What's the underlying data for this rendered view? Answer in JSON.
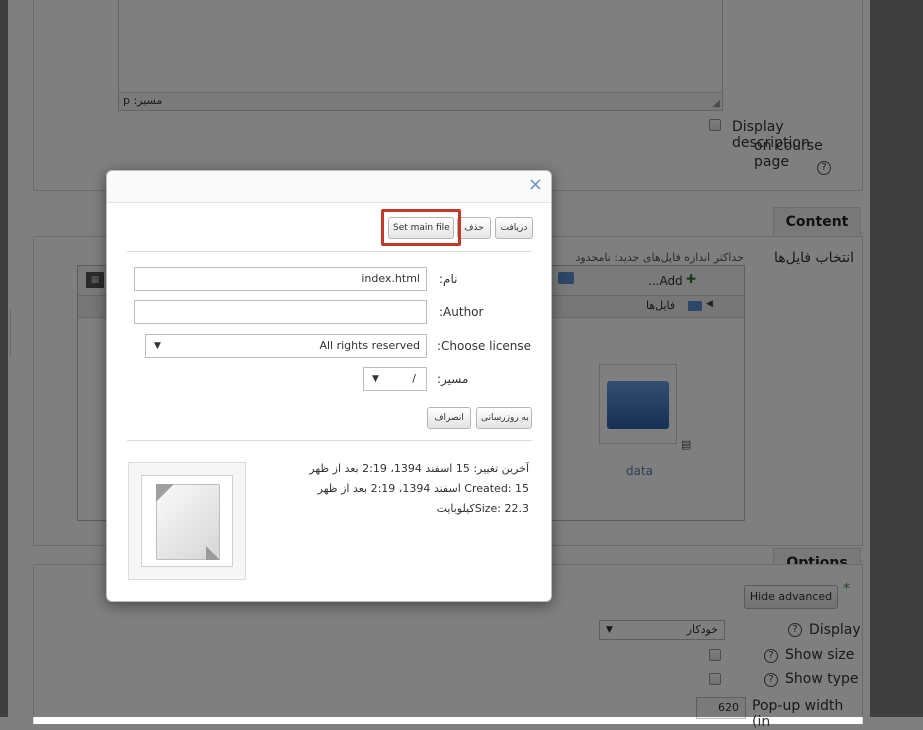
{
  "background": {
    "textarea": {
      "path_label": "مسیر: p"
    },
    "description": {
      "line1": "Display description",
      "line2": "on course page",
      "help_glyph": "?"
    },
    "content_section": {
      "tab": "Content",
      "select_files_label": "انتخاب فایل‌ها",
      "max_size_note": "حداکثر اندازه فایل‌های جدید: نامحدود",
      "add_label": "...Add",
      "files_breadcrumb": "فایل‌ها",
      "folder_name": "data"
    },
    "options_section": {
      "tab": "Options",
      "hide_advanced": "Hide advanced",
      "required_marker": "*",
      "display_select": "خودکار",
      "display_label": "Display",
      "show_size_label": "Show size",
      "show_type_label": "Show type",
      "popup_width_value": "620",
      "popup_width_label": "Pop-up width (in"
    }
  },
  "dialog": {
    "close_glyph": "×",
    "toolbar": {
      "download": "دریافت",
      "delete": "حذف",
      "set_main_file": "Set main file"
    },
    "form": {
      "name_label": "نام:",
      "name_value": "index.html",
      "author_label": ":Author",
      "author_value": "",
      "license_label": ":Choose license",
      "license_value": "All rights reserved",
      "path_label": "مسیر:",
      "path_value": "/"
    },
    "actions": {
      "update": "به روزرسانی",
      "cancel": "انصراف"
    },
    "info": {
      "modified": "آخرین تغییر: 15 اسفند 1394، 2:19 بعد از ظهر",
      "created": "Created: 15 اسفند 1394، 2:19 بعد از ظهر",
      "size": "Size: 22.3کیلوبایت"
    }
  },
  "colors": {
    "highlight": "#c0392b",
    "close": "#6a8fc7",
    "folder": "#3f6fb0"
  }
}
